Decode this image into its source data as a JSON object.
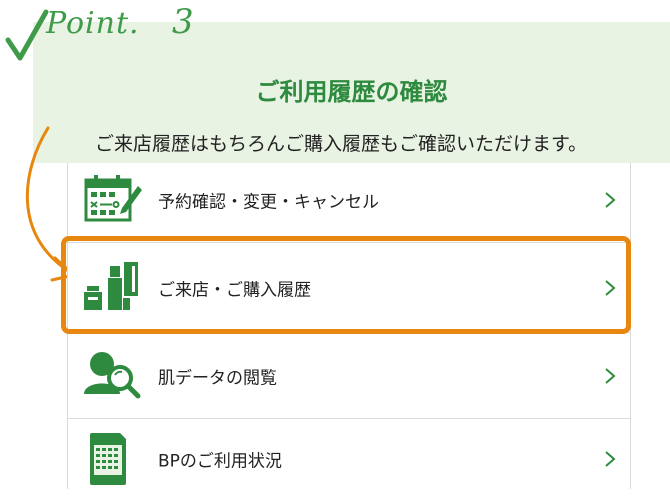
{
  "point": {
    "word": "Point.",
    "number": "3",
    "title": "ご利用履歴の確認",
    "description": "ご来店履歴はもちろんご購入履歴もご確認いただけます。"
  },
  "menu": {
    "items": [
      {
        "label": "予約確認・変更・キャンセル",
        "icon": "calendar-edit-icon"
      },
      {
        "label": "ご来店・ご購入履歴",
        "icon": "cosmetics-products-icon",
        "highlighted": true
      },
      {
        "label": "肌データの閲覧",
        "icon": "person-magnifier-icon"
      },
      {
        "label": "BPのご利用状況",
        "icon": "point-card-icon"
      }
    ]
  },
  "colors": {
    "green": "#3f9a4a",
    "dark_green": "#2d8a3e",
    "banner_bg": "#e9f3e4",
    "highlight": "#e8870f",
    "chevron": "#2e8a3e"
  }
}
